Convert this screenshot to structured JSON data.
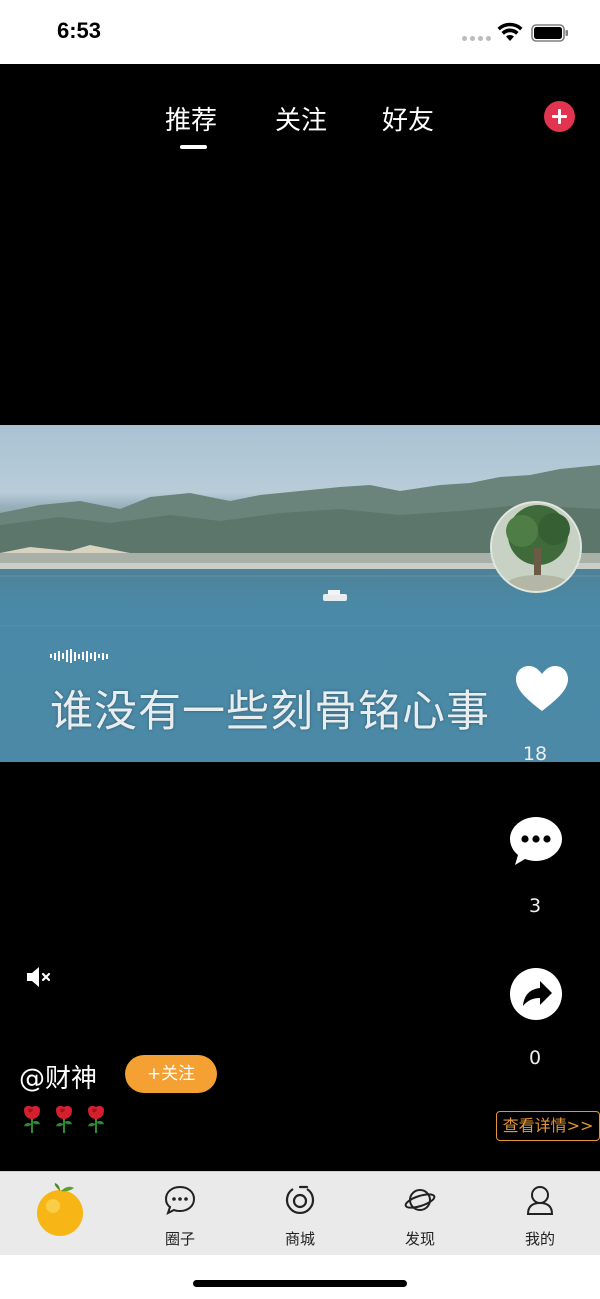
{
  "status_bar": {
    "time": "6:53"
  },
  "top_tabs": [
    {
      "label": "推荐",
      "active": true
    },
    {
      "label": "关注",
      "active": false
    },
    {
      "label": "好友",
      "active": false
    }
  ],
  "video": {
    "subtitle": "谁没有一些刻骨铭心事"
  },
  "actions": {
    "like_count": "18",
    "comment_count": "3",
    "share_count": "0"
  },
  "post": {
    "username": "@财神",
    "follow_label": "+关注",
    "roses_emoji": [
      "🌹",
      "🌹",
      "🌹"
    ],
    "details_label": "查看详情>>"
  },
  "tab_bar": {
    "items": [
      {
        "label": "",
        "icon": "orange-icon"
      },
      {
        "label": "圈子",
        "icon": "chat-bubble-icon"
      },
      {
        "label": "商城",
        "icon": "store-icon"
      },
      {
        "label": "发现",
        "icon": "planet-icon"
      },
      {
        "label": "我的",
        "icon": "profile-icon"
      }
    ]
  },
  "colors": {
    "accent_red": "#e0344f",
    "follow_orange": "#f4a032",
    "details_orange": "#e49636"
  }
}
